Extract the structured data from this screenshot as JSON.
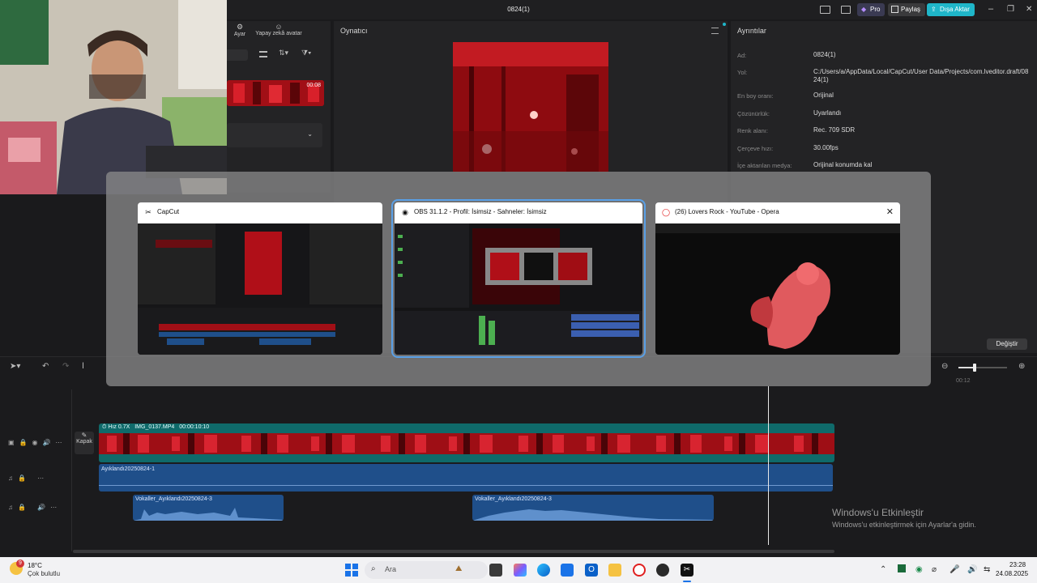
{
  "window": {
    "title": "0824(1)",
    "pro_label": "Pro",
    "share_label": "Paylaş",
    "export_label": "Dışa Aktar"
  },
  "toolbar": {
    "adjust_label": "Ayar",
    "ai_avatar_label": "Yapay zekâ avatar"
  },
  "media": {
    "clip_duration": "00:08"
  },
  "player": {
    "title": "Oynatıcı"
  },
  "details": {
    "title": "Ayrıntılar",
    "rows": [
      {
        "key": "Ad:",
        "value": "0824(1)"
      },
      {
        "key": "Yol:",
        "value": "C:/Users/a/AppData/Local/CapCut/User Data/Projects/com.lveditor.draft/0824(1)"
      },
      {
        "key": "En boy oranı:",
        "value": "Orijinal"
      },
      {
        "key": "Çözünürlük:",
        "value": "Uyarlandı"
      },
      {
        "key": "Renk alanı:",
        "value": "Rec. 709 SDR"
      },
      {
        "key": "Çerçeve hızı:",
        "value": "30.00fps"
      },
      {
        "key": "İçe aktarılan medya:",
        "value": "Orijinal konumda kal"
      }
    ],
    "change_label": "Değiştir"
  },
  "timeline": {
    "ruler_mark": "00:12",
    "cover_label": "Kapak",
    "video_clip": {
      "speed": "Hız 0.7X",
      "name": "IMG_0137.MP4",
      "duration": "00:00:10:10"
    },
    "audio_main": "Ayıklandı20250824-1",
    "vocal_clip_1": "Vokaller_Ayıklandı20250824-3",
    "vocal_clip_2": "Vokaller_Ayıklandı20250824-3"
  },
  "switcher": {
    "windows": [
      {
        "title": "CapCut"
      },
      {
        "title": "OBS 31.1.2 - Profil: İsimsiz - Sahneler: İsimsiz"
      },
      {
        "title": "(26) Lovers Rock - YouTube - Opera"
      }
    ]
  },
  "activation": {
    "title": "Windows'u Etkinleştir",
    "subtitle": "Windows'u etkinleştirmek için Ayarlar'a gidin."
  },
  "taskbar": {
    "weather_temp": "18°C",
    "weather_desc": "Çok bulutlu",
    "weather_badge": "9",
    "search_placeholder": "Ara",
    "time": "23:28",
    "date": "24.08.2025"
  },
  "colors": {
    "accent": "#1fb6c9",
    "clip_red": "#c0131c",
    "audio_blue": "#1f4f8a",
    "teal": "#0f6a6a"
  }
}
